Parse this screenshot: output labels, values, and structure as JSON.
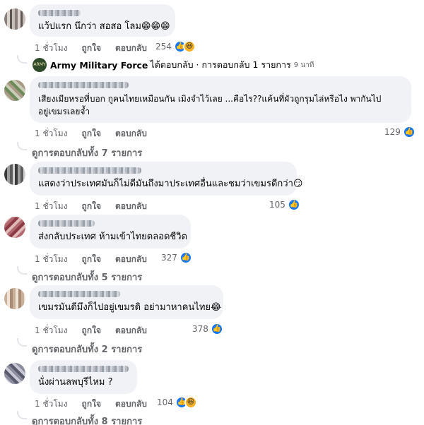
{
  "comments": [
    {
      "text": "แว้ปแรก นึกว่า สอสอ โลม😁😁😁",
      "time": "1 ชั่วโมง",
      "like": "ถูกใจ",
      "reply": "ตอบกลับ",
      "reactions": "254"
    },
    {
      "text_line1": "เสียงเมียหรอที่บอก กูคนไทยเหมือนกัน เมิงจำไว้เลย ...คือไร??แค้นที่ผัวถูกรุมไล่หรือไง พากันไป",
      "text_line2": "อยู่เขมรเลยจ้ำ",
      "time": "1 ชั่วโมง",
      "like": "ถูกใจ",
      "reply": "ตอบกลับ",
      "reactions": "129",
      "view_replies": "ดูการตอบกลับทั้ง 7 รายการ"
    },
    {
      "text": "แสดงว่าประเทศมันก็ไม่ดีมันถึงมาประเทศอื่นและชมว่าเขมรดีกว่า😏",
      "time": "1 ชั่วโมง",
      "like": "ถูกใจ",
      "reply": "ตอบกลับ",
      "reactions": "105"
    },
    {
      "text": "ส่งกลับประเทศ ห้ามเข้าไทยตลอดชีวิต",
      "time": "1 ชั่วโมง",
      "like": "ถูกใจ",
      "reply": "ตอบกลับ",
      "reactions": "327",
      "view_replies": "ดูการตอบกลับทั้ง 5 รายการ"
    },
    {
      "text": "เขมรมันดีมึงก็ไปอยู่เขมรดิ อย่ามาหาคนไทย😂",
      "time": "1 ชั่วโมง",
      "like": "ถูกใจ",
      "reply": "ตอบกลับ",
      "reactions": "378",
      "view_replies": "ดูการตอบกลับทั้ง 2 รายการ"
    },
    {
      "text": "นั่งผ่านลพบุรีไหม ?",
      "time": "1 ชั่วโมง",
      "like": "ถูกใจ",
      "reply": "ตอบกลับ",
      "reactions": "104",
      "view_replies": "ดูการตอบกลับทั้ง 8 รายการ"
    }
  ],
  "page_reply": {
    "logo_text": "ARMY",
    "name": "Army Military Force",
    "action": "ได้ตอบกลับ · การตอบกลับ 1 รายการ",
    "time": "9 นาที"
  },
  "colors": {
    "bubble": "#f0f2f5",
    "meta": "#65676b",
    "like": "#1877f2",
    "haha": "#f7b125"
  }
}
